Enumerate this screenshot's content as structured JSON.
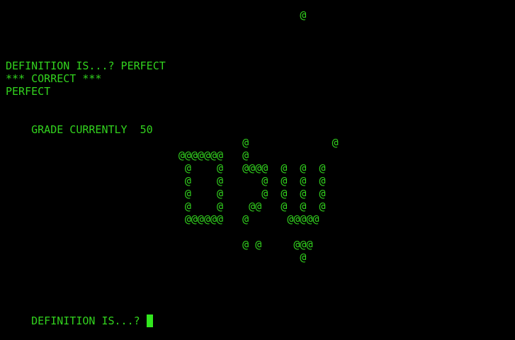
{
  "colors": {
    "background": "#000000",
    "text": "#32d21e",
    "cursor": "#32e61e"
  },
  "terminal": {
    "top_art": "                                              @",
    "definition_prompt_answered": "DEFINITION IS...? PERFECT",
    "result": "*** CORRECT ***",
    "word": "PERFECT",
    "grade_label": "GRADE CURRENTLY",
    "grade_value": "50",
    "art_lines": [
      "                                     @             @",
      "                           @@@@@@@   @",
      "                            @    @   @@@@  @  @  @",
      "                            @    @      @  @  @  @",
      "                            @    @      @  @  @  @",
      "                            @    @    @@   @  @  @",
      "                            @@@@@@   @      @@@@@",
      "",
      "                                     @ @     @@@",
      "                                              @"
    ],
    "input_prompt": "DEFINITION IS...? ",
    "input_value": ""
  }
}
